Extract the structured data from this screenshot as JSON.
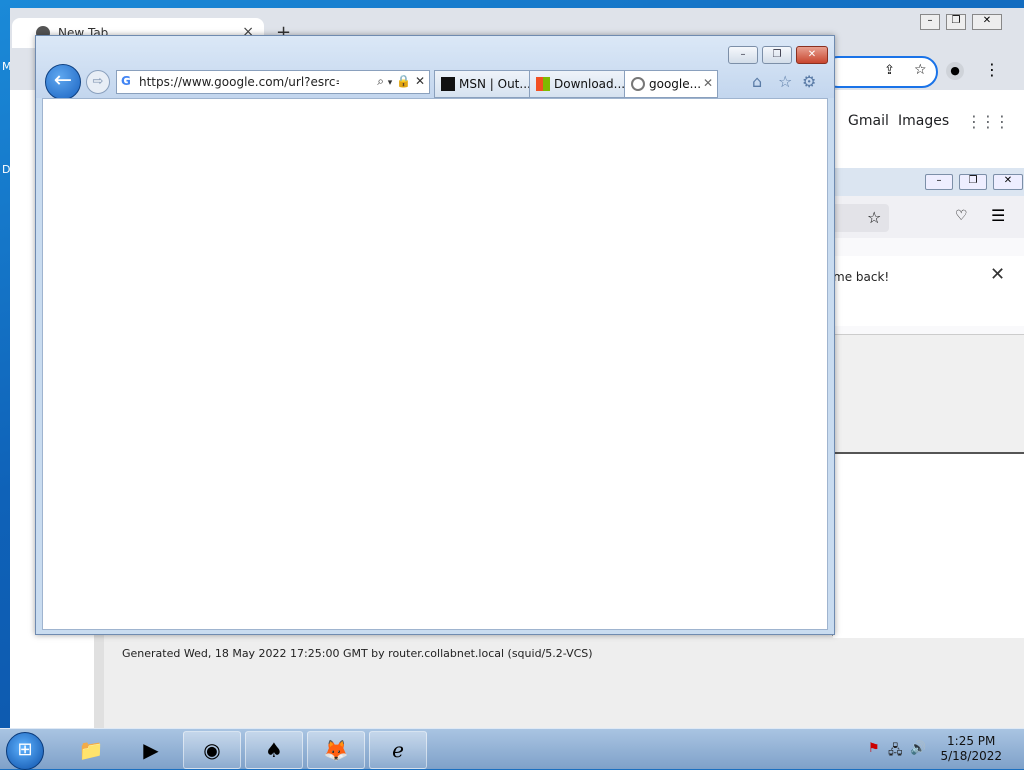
{
  "desktop": {
    "edge_letters": [
      "M",
      "D"
    ]
  },
  "chrome": {
    "tab_title": "New Tab",
    "tab_close": "×",
    "new_tab": "+",
    "links": [
      "Gmail",
      "Images"
    ],
    "squid_footer": "Generated Wed, 18 May 2022 17:25:00 GMT by router.collabnet.local (squid/5.2-VCS)"
  },
  "firefox": {
    "notice_text": "me back!"
  },
  "ie": {
    "address": "https://www.google.com/url?esrc=s&q=",
    "tabs": [
      {
        "label": "MSN | Out...",
        "icon": "msn-icon"
      },
      {
        "label": "Download...",
        "icon": "microsoft-icon"
      },
      {
        "label": "google...",
        "icon": "loading-icon",
        "active": true
      }
    ]
  },
  "taskbar": {
    "time": "1:25 PM",
    "date": "5/18/2022",
    "apps": [
      "file-explorer",
      "media-player",
      "chrome",
      "solitaire",
      "firefox",
      "internet-explorer"
    ]
  }
}
